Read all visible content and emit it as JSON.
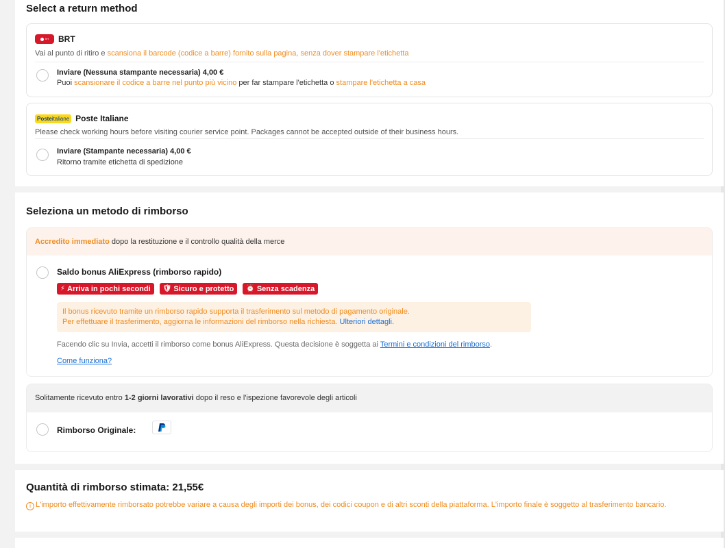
{
  "return_method": {
    "title": "Select a return method",
    "brt": {
      "name": "BRT",
      "desc_prefix": "Vai al punto di ritiro e ",
      "desc_highlight": "scansiona il barcode (codice a barre) fornito sulla pagina, senza dover stampare l'etichetta",
      "option_title": "Inviare (Nessuna stampante necessaria) 4,00 €",
      "sub_1": "Puoi ",
      "sub_2": "scansionare il codice a barre nel punto più vicino",
      "sub_3": " per far stampare l'etichetta o ",
      "sub_4": "stampare l'etichetta a casa"
    },
    "poste": {
      "logo_strong": "Poste",
      "logo_light": "italiane",
      "name": "Poste Italiane",
      "desc": "Please check working hours before visiting courier service point. Packages cannot be accepted outside of their business hours.",
      "option_title": "Inviare (Stampante necessaria) 4,00 €",
      "option_sub": "Ritorno tramite etichetta di spedizione"
    }
  },
  "refund_method": {
    "title": "Seleziona un metodo di rimborso",
    "banner_highlight": "Accredito immediato",
    "banner_rest": " dopo la restituzione e il controllo qualità della merce",
    "bonus_option": "Saldo bonus AliExpress (rimborso rapido)",
    "badges": [
      {
        "icon": "⚡",
        "label": "Arriva in pochi secondi"
      },
      {
        "icon": "🛡",
        "label": "Sicuro e protetto"
      },
      {
        "icon": "⏰",
        "label": "Senza scadenza"
      }
    ],
    "info_line_1": "Il bonus ricevuto tramite un rimborso rapido supporta il trasferimento sul metodo di pagamento originale.",
    "info_line_2": "Per effettuare il trasferimento, aggiorna le informazioni del rimborso nella richiesta. ",
    "info_link": "Ulteriori dettagli.",
    "terms_prefix": "Facendo clic su Invia, accetti il rimborso come bonus AliExpress. Questa decisione è soggetta ai ",
    "terms_link": "Termini e condizioni del rimborso",
    "terms_suffix": ".",
    "how_link": "Come funziona?",
    "orig_banner_1": "Solitamente ricevuto entro ",
    "orig_banner_bold": "1-2 giorni lavorativi",
    "orig_banner_2": " dopo il reso e l'ispezione favorevole degli articoli",
    "orig_option": "Rimborso Originale:",
    "paypal_icon": "paypal-icon"
  },
  "estimate": {
    "title": "Quantità di rimborso stimata: 21,55€",
    "disclaimer": "L'importo effettivamente rimborsato potrebbe variare a causa degli importi dei bonus, dei codici coupon e di altri sconti della piattaforma. L'importo finale è soggetto al trasferimento bancario."
  },
  "colors": {
    "accent_orange": "#f08b1d",
    "badge_red": "#d7182a",
    "link_blue": "#1a6fd4"
  }
}
